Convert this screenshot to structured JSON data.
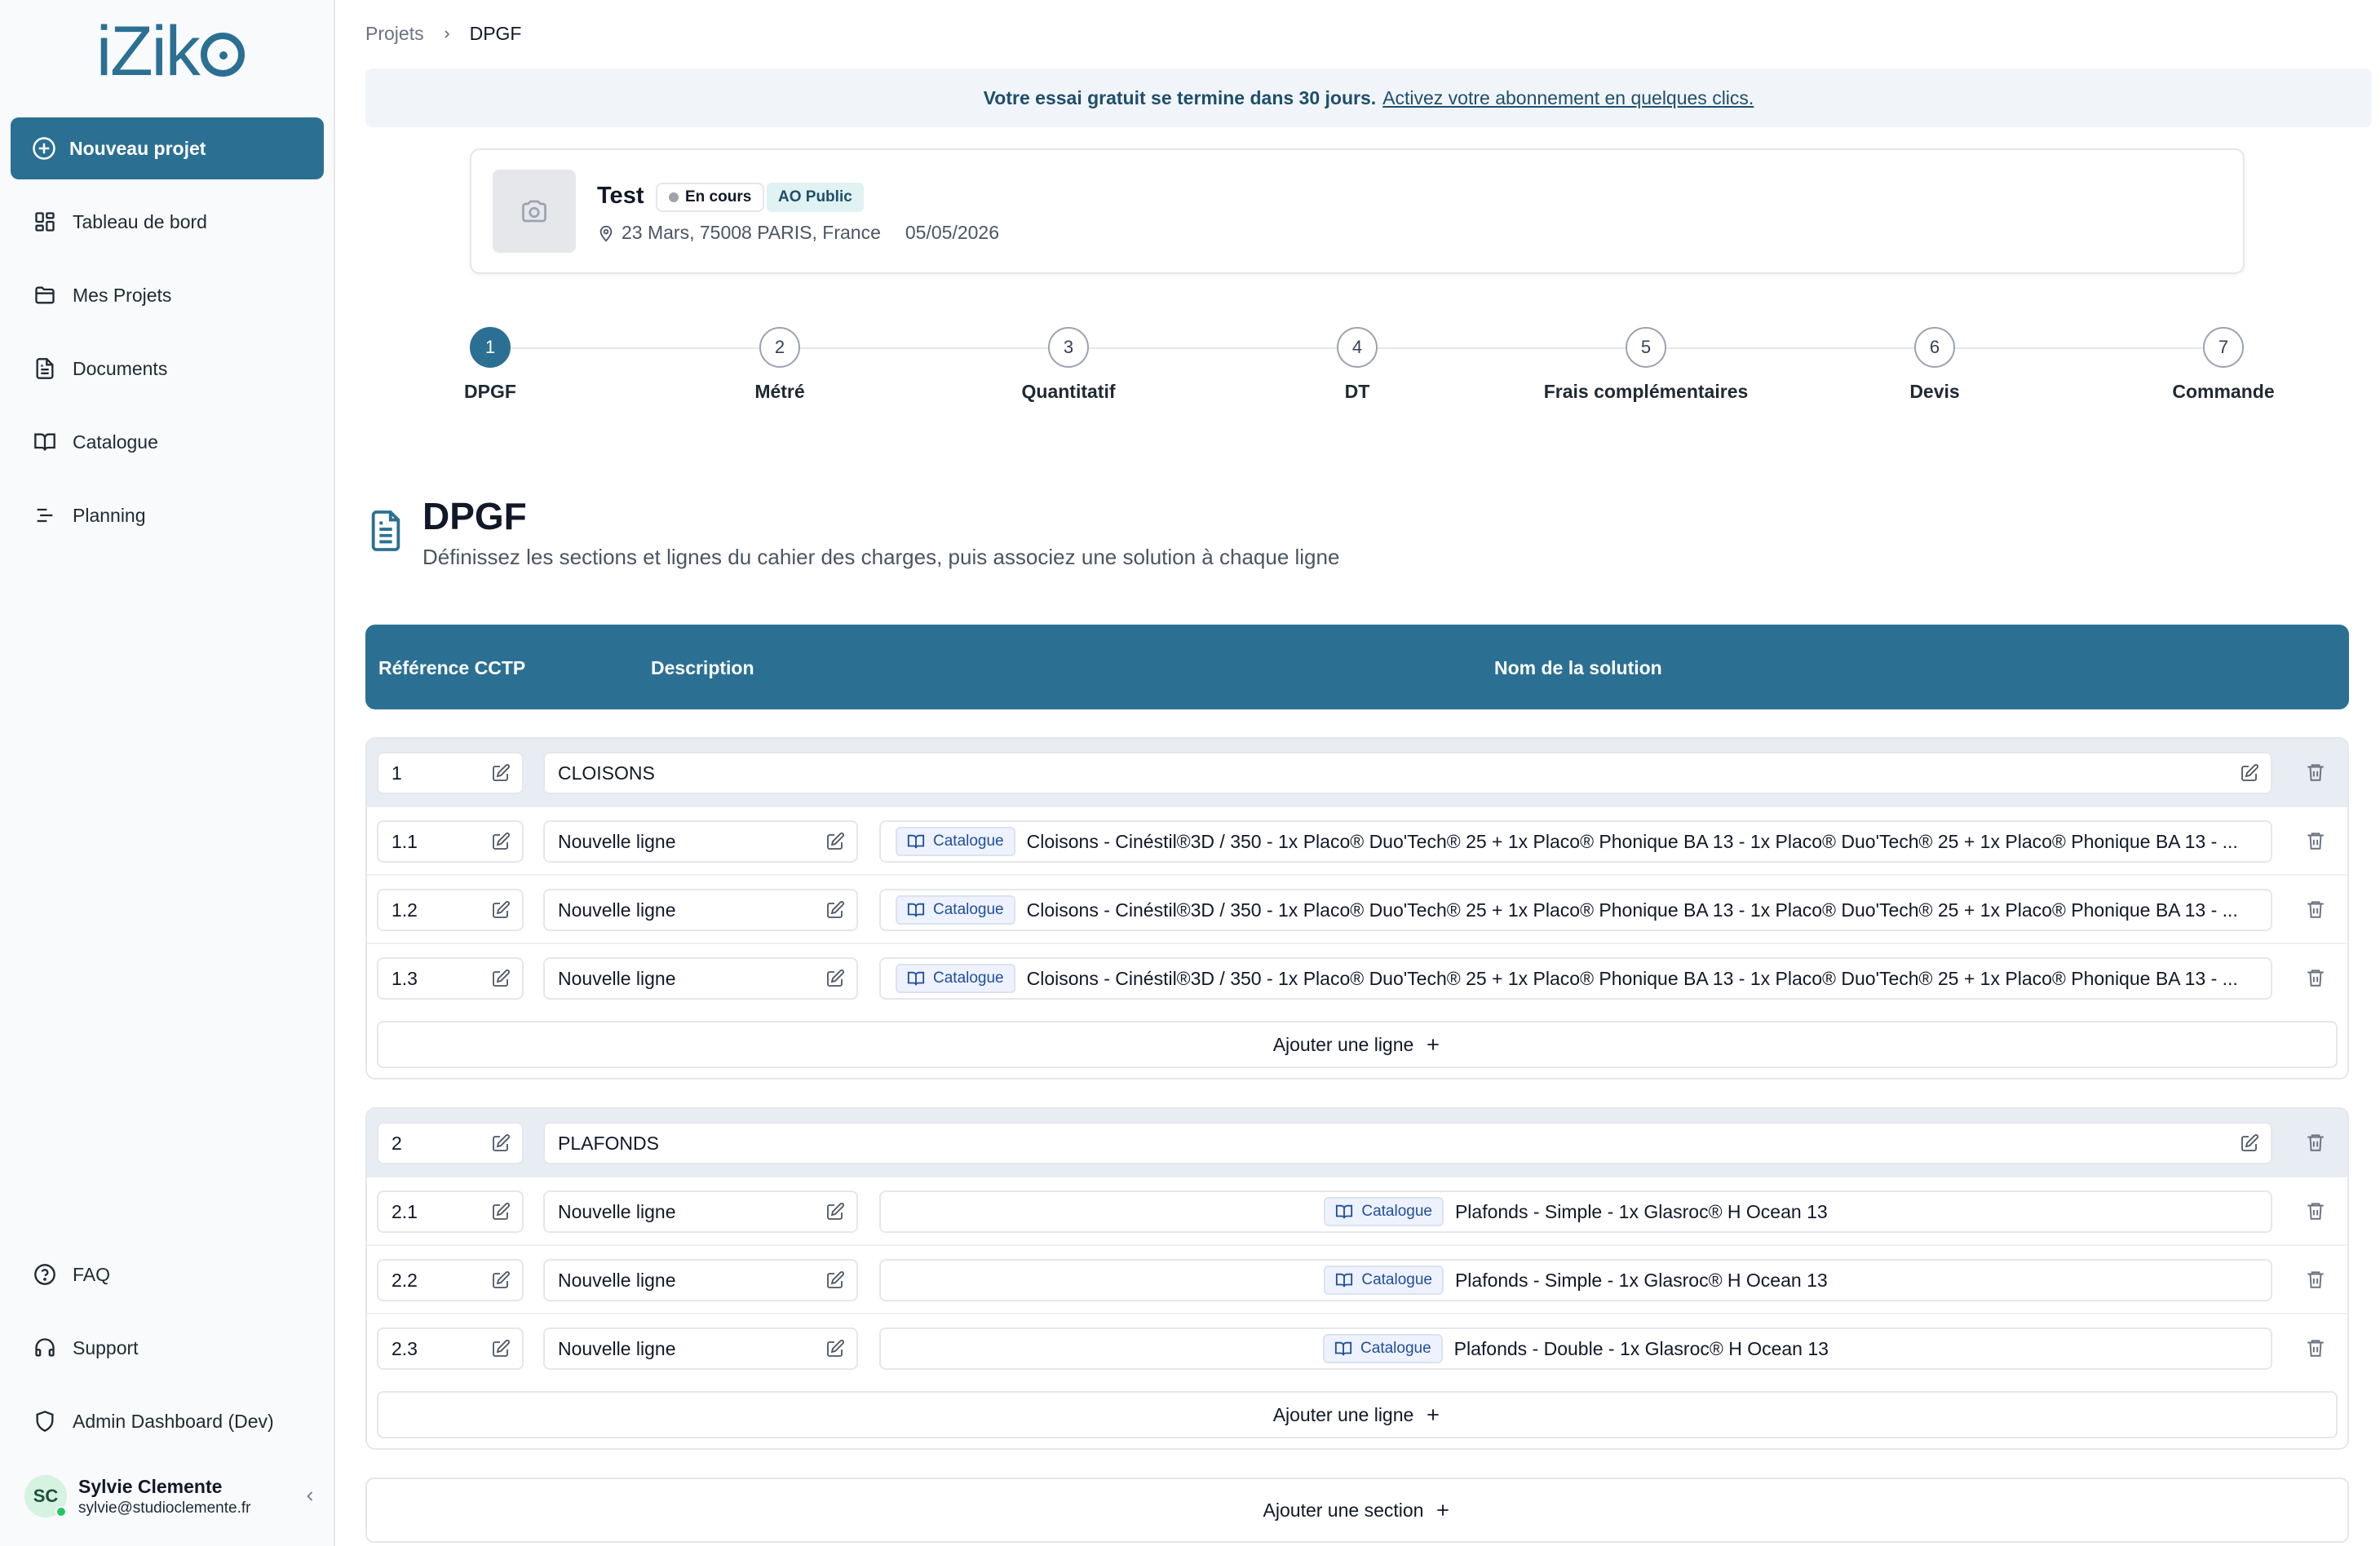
{
  "sidebar": {
    "logo": "iZiko",
    "new_project": "Nouveau projet",
    "items": [
      {
        "label": "Tableau de bord",
        "icon": "dashboard-icon"
      },
      {
        "label": "Mes Projets",
        "icon": "folder-icon"
      },
      {
        "label": "Documents",
        "icon": "document-icon"
      },
      {
        "label": "Catalogue",
        "icon": "book-icon"
      },
      {
        "label": "Planning",
        "icon": "planning-icon"
      }
    ],
    "bottom_items": [
      {
        "label": "FAQ",
        "icon": "help-icon"
      },
      {
        "label": "Support",
        "icon": "headset-icon"
      },
      {
        "label": "Admin Dashboard (Dev)",
        "icon": "shield-icon"
      }
    ],
    "user": {
      "initials": "SC",
      "name": "Sylvie Clemente",
      "email": "sylvie@studioclemente.fr"
    }
  },
  "breadcrumb": {
    "parent": "Projets",
    "current": "DPGF"
  },
  "trial": {
    "text": "Votre essai gratuit se termine dans 30 jours.",
    "link": "Activez votre abonnement en quelques clics."
  },
  "project": {
    "title": "Test",
    "status": "En cours",
    "type": "AO Public",
    "address": "23 Mars, 75008 PARIS, France",
    "date": "05/05/2026"
  },
  "steps": [
    {
      "num": "1",
      "label": "DPGF"
    },
    {
      "num": "2",
      "label": "Métré"
    },
    {
      "num": "3",
      "label": "Quantitatif"
    },
    {
      "num": "4",
      "label": "DT"
    },
    {
      "num": "5",
      "label": "Frais complémentaires"
    },
    {
      "num": "6",
      "label": "Devis"
    },
    {
      "num": "7",
      "label": "Commande"
    }
  ],
  "section_header": {
    "title": "DPGF",
    "subtitle": "Définissez les sections et lignes du cahier des charges, puis associez une solution à chaque ligne"
  },
  "table": {
    "col_ref": "Référence CCTP",
    "col_desc": "Description",
    "col_solution": "Nom de la solution"
  },
  "catalogue_label": "Catalogue",
  "sections": [
    {
      "ref": "1",
      "name": "CLOISONS",
      "rows": [
        {
          "ref": "1.1",
          "desc": "Nouvelle ligne",
          "solution": "Cloisons - Cinéstil®3D / 350 - 1x Placo® Duo'Tech® 25 + 1x Placo® Phonique BA 13 - 1x Placo® Duo'Tech® 25 + 1x Placo® Phonique BA 13 - ..."
        },
        {
          "ref": "1.2",
          "desc": "Nouvelle ligne",
          "solution": "Cloisons - Cinéstil®3D / 350 - 1x Placo® Duo'Tech® 25 + 1x Placo® Phonique BA 13 - 1x Placo® Duo'Tech® 25 + 1x Placo® Phonique BA 13 - ..."
        },
        {
          "ref": "1.3",
          "desc": "Nouvelle ligne",
          "solution": "Cloisons - Cinéstil®3D / 350 - 1x Placo® Duo'Tech® 25 + 1x Placo® Phonique BA 13 - 1x Placo® Duo'Tech® 25 + 1x Placo® Phonique BA 13 - ..."
        }
      ]
    },
    {
      "ref": "2",
      "name": "PLAFONDS",
      "rows": [
        {
          "ref": "2.1",
          "desc": "Nouvelle ligne",
          "solution": "Plafonds - Simple - 1x Glasroc® H Ocean 13"
        },
        {
          "ref": "2.2",
          "desc": "Nouvelle ligne",
          "solution": "Plafonds - Simple - 1x Glasroc® H Ocean 13"
        },
        {
          "ref": "2.3",
          "desc": "Nouvelle ligne",
          "solution": "Plafonds - Double - 1x Glasroc® H Ocean 13"
        }
      ]
    }
  ],
  "add_line": "Ajouter une ligne",
  "add_section": "Ajouter une section",
  "colors": {
    "primary": "#2b7093",
    "sidebar_bg": "#f8fafc",
    "section_head_bg": "#e8edf3"
  }
}
